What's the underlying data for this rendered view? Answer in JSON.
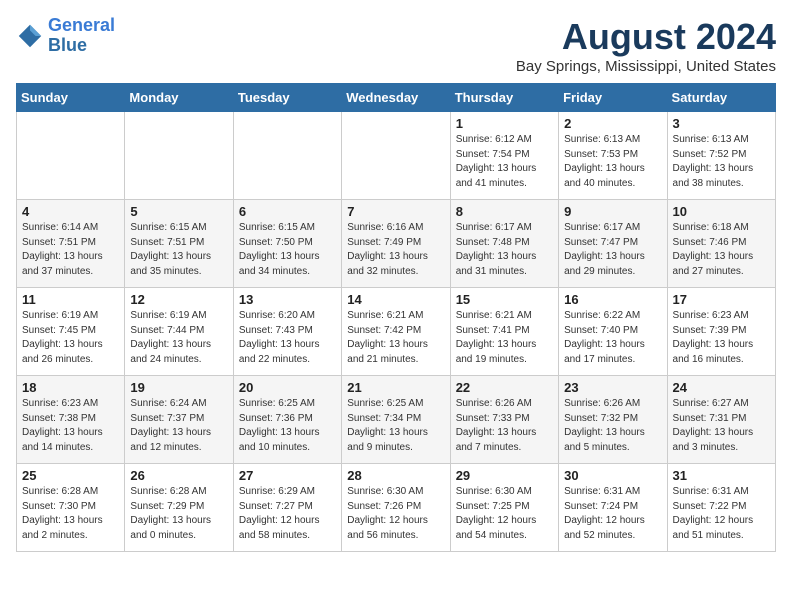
{
  "logo": {
    "line1": "General",
    "line2": "Blue"
  },
  "title": "August 2024",
  "location": "Bay Springs, Mississippi, United States",
  "days_of_week": [
    "Sunday",
    "Monday",
    "Tuesday",
    "Wednesday",
    "Thursday",
    "Friday",
    "Saturday"
  ],
  "weeks": [
    [
      {
        "day": "",
        "info": ""
      },
      {
        "day": "",
        "info": ""
      },
      {
        "day": "",
        "info": ""
      },
      {
        "day": "",
        "info": ""
      },
      {
        "day": "1",
        "info": "Sunrise: 6:12 AM\nSunset: 7:54 PM\nDaylight: 13 hours\nand 41 minutes."
      },
      {
        "day": "2",
        "info": "Sunrise: 6:13 AM\nSunset: 7:53 PM\nDaylight: 13 hours\nand 40 minutes."
      },
      {
        "day": "3",
        "info": "Sunrise: 6:13 AM\nSunset: 7:52 PM\nDaylight: 13 hours\nand 38 minutes."
      }
    ],
    [
      {
        "day": "4",
        "info": "Sunrise: 6:14 AM\nSunset: 7:51 PM\nDaylight: 13 hours\nand 37 minutes."
      },
      {
        "day": "5",
        "info": "Sunrise: 6:15 AM\nSunset: 7:51 PM\nDaylight: 13 hours\nand 35 minutes."
      },
      {
        "day": "6",
        "info": "Sunrise: 6:15 AM\nSunset: 7:50 PM\nDaylight: 13 hours\nand 34 minutes."
      },
      {
        "day": "7",
        "info": "Sunrise: 6:16 AM\nSunset: 7:49 PM\nDaylight: 13 hours\nand 32 minutes."
      },
      {
        "day": "8",
        "info": "Sunrise: 6:17 AM\nSunset: 7:48 PM\nDaylight: 13 hours\nand 31 minutes."
      },
      {
        "day": "9",
        "info": "Sunrise: 6:17 AM\nSunset: 7:47 PM\nDaylight: 13 hours\nand 29 minutes."
      },
      {
        "day": "10",
        "info": "Sunrise: 6:18 AM\nSunset: 7:46 PM\nDaylight: 13 hours\nand 27 minutes."
      }
    ],
    [
      {
        "day": "11",
        "info": "Sunrise: 6:19 AM\nSunset: 7:45 PM\nDaylight: 13 hours\nand 26 minutes."
      },
      {
        "day": "12",
        "info": "Sunrise: 6:19 AM\nSunset: 7:44 PM\nDaylight: 13 hours\nand 24 minutes."
      },
      {
        "day": "13",
        "info": "Sunrise: 6:20 AM\nSunset: 7:43 PM\nDaylight: 13 hours\nand 22 minutes."
      },
      {
        "day": "14",
        "info": "Sunrise: 6:21 AM\nSunset: 7:42 PM\nDaylight: 13 hours\nand 21 minutes."
      },
      {
        "day": "15",
        "info": "Sunrise: 6:21 AM\nSunset: 7:41 PM\nDaylight: 13 hours\nand 19 minutes."
      },
      {
        "day": "16",
        "info": "Sunrise: 6:22 AM\nSunset: 7:40 PM\nDaylight: 13 hours\nand 17 minutes."
      },
      {
        "day": "17",
        "info": "Sunrise: 6:23 AM\nSunset: 7:39 PM\nDaylight: 13 hours\nand 16 minutes."
      }
    ],
    [
      {
        "day": "18",
        "info": "Sunrise: 6:23 AM\nSunset: 7:38 PM\nDaylight: 13 hours\nand 14 minutes."
      },
      {
        "day": "19",
        "info": "Sunrise: 6:24 AM\nSunset: 7:37 PM\nDaylight: 13 hours\nand 12 minutes."
      },
      {
        "day": "20",
        "info": "Sunrise: 6:25 AM\nSunset: 7:36 PM\nDaylight: 13 hours\nand 10 minutes."
      },
      {
        "day": "21",
        "info": "Sunrise: 6:25 AM\nSunset: 7:34 PM\nDaylight: 13 hours\nand 9 minutes."
      },
      {
        "day": "22",
        "info": "Sunrise: 6:26 AM\nSunset: 7:33 PM\nDaylight: 13 hours\nand 7 minutes."
      },
      {
        "day": "23",
        "info": "Sunrise: 6:26 AM\nSunset: 7:32 PM\nDaylight: 13 hours\nand 5 minutes."
      },
      {
        "day": "24",
        "info": "Sunrise: 6:27 AM\nSunset: 7:31 PM\nDaylight: 13 hours\nand 3 minutes."
      }
    ],
    [
      {
        "day": "25",
        "info": "Sunrise: 6:28 AM\nSunset: 7:30 PM\nDaylight: 13 hours\nand 2 minutes."
      },
      {
        "day": "26",
        "info": "Sunrise: 6:28 AM\nSunset: 7:29 PM\nDaylight: 13 hours\nand 0 minutes."
      },
      {
        "day": "27",
        "info": "Sunrise: 6:29 AM\nSunset: 7:27 PM\nDaylight: 12 hours\nand 58 minutes."
      },
      {
        "day": "28",
        "info": "Sunrise: 6:30 AM\nSunset: 7:26 PM\nDaylight: 12 hours\nand 56 minutes."
      },
      {
        "day": "29",
        "info": "Sunrise: 6:30 AM\nSunset: 7:25 PM\nDaylight: 12 hours\nand 54 minutes."
      },
      {
        "day": "30",
        "info": "Sunrise: 6:31 AM\nSunset: 7:24 PM\nDaylight: 12 hours\nand 52 minutes."
      },
      {
        "day": "31",
        "info": "Sunrise: 6:31 AM\nSunset: 7:22 PM\nDaylight: 12 hours\nand 51 minutes."
      }
    ]
  ]
}
